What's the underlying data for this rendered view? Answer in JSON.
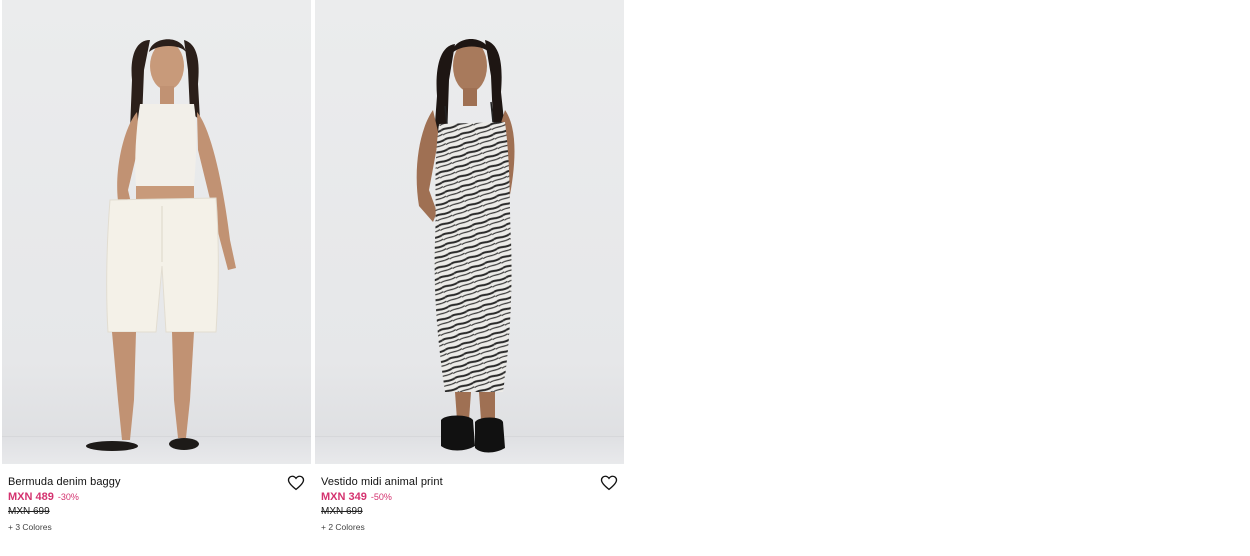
{
  "products": [
    {
      "name": "Bermuda denim baggy",
      "price": "MXN 489",
      "discount": "-30%",
      "old_price": "MXN 699",
      "colors": "+ 3 Colores",
      "image": "woman-white-crop-top-white-bermuda-shorts"
    },
    {
      "name": "Vestido midi animal print",
      "price": "MXN 349",
      "discount": "-50%",
      "old_price": "MXN 699",
      "colors": "+ 2 Colores",
      "image": "woman-zebra-print-midi-dress"
    }
  ],
  "colors": {
    "sale": "#d4326f",
    "text": "#111111",
    "background": "#ffffff"
  },
  "icons": {
    "favorite": "heart-outline-icon"
  }
}
